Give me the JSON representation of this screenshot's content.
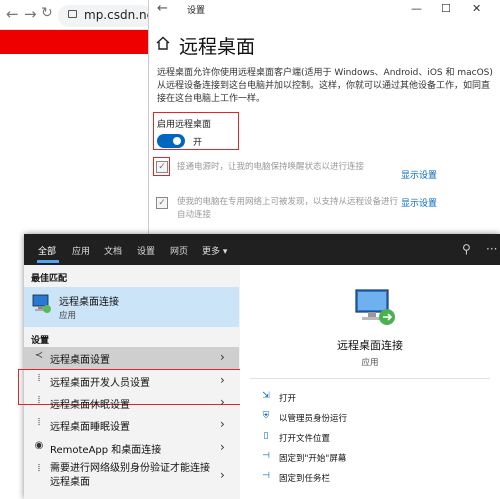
{
  "browser": {
    "url": "mp.csdn.net/pc"
  },
  "settings": {
    "window_title": "设置",
    "page_title": "远程桌面",
    "description": "远程桌面允许你使用远程桌面客户端(适用于 Windows、Android、iOS 和 macOS)从远程设备连接到这台电脑并加以控制。这样，你就可以通过其他设备工作，如同直接在这台电脑上工作一样。",
    "enable_label": "启用远程桌面",
    "toggle_state": "开",
    "toggle_on": true,
    "option1": "接通电源时，让我的电脑保持唤醒状态以进行连接",
    "option2": "使我的电脑在专用网络上可被发现，以支持从远程设备进行自动连接",
    "show_settings_1": "显示设置",
    "show_settings_2": "显示设置"
  },
  "search": {
    "tabs": [
      "全部",
      "应用",
      "文档",
      "设置",
      "网页",
      "更多 ▾"
    ],
    "best_match_heading": "最佳匹配",
    "best_match": {
      "name": "远程桌面连接",
      "type": "应用"
    },
    "settings_heading": "设置",
    "results": [
      "远程桌面设置",
      "远程桌面开发人员设置",
      "远程桌面休眠设置",
      "远程桌面睡眠设置",
      "RemoteApp 和桌面连接",
      "需要进行网络级别身份验证才能连接远程桌面"
    ],
    "preview": {
      "title": "远程桌面连接",
      "subtitle": "应用",
      "actions": [
        "打开",
        "以管理员身份运行",
        "打开文件位置",
        "固定到\"开始\"屏幕",
        "固定到任务栏"
      ]
    }
  },
  "colors": {
    "accent": "#0067c0",
    "highlight_box": "#e0262c",
    "search_bar": "#202020"
  }
}
